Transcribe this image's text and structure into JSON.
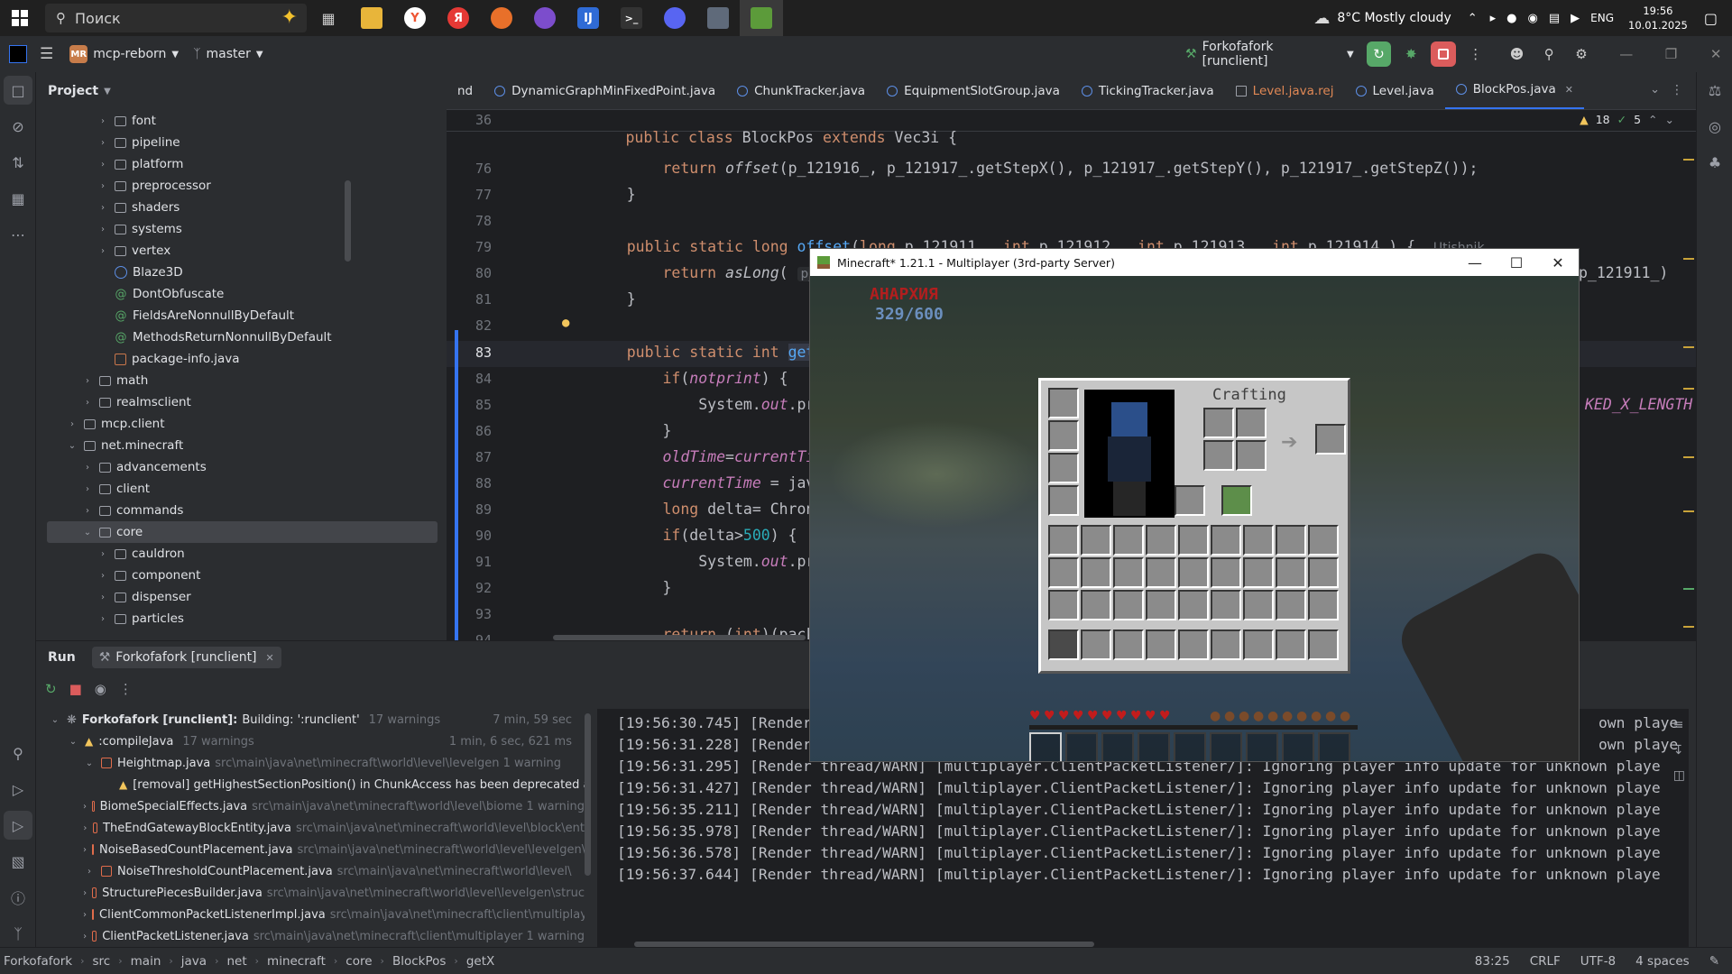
{
  "taskbar": {
    "search_placeholder": "Поиск",
    "weather": "8°C  Mostly cloudy",
    "lang": "ENG",
    "time": "19:56",
    "date": "10.01.2025"
  },
  "ide": {
    "project_badge": "MR",
    "project_name": "mcp-reborn",
    "branch": "master",
    "run_config": "Forkofafork [runclient]"
  },
  "project_panel": {
    "title": "Project",
    "items": [
      {
        "label": "font",
        "type": "folder",
        "depth": 3
      },
      {
        "label": "pipeline",
        "type": "folder",
        "depth": 3
      },
      {
        "label": "platform",
        "type": "folder",
        "depth": 3
      },
      {
        "label": "preprocessor",
        "type": "folder",
        "depth": 3
      },
      {
        "label": "shaders",
        "type": "folder",
        "depth": 3
      },
      {
        "label": "systems",
        "type": "folder",
        "depth": 3
      },
      {
        "label": "vertex",
        "type": "folder",
        "depth": 3
      },
      {
        "label": "Blaze3D",
        "type": "class",
        "depth": 3
      },
      {
        "label": "DontObfuscate",
        "type": "annotation",
        "depth": 3
      },
      {
        "label": "FieldsAreNonnullByDefault",
        "type": "annotation",
        "depth": 3
      },
      {
        "label": "MethodsReturnNonnullByDefault",
        "type": "annotation",
        "depth": 3
      },
      {
        "label": "package-info.java",
        "type": "file",
        "depth": 3
      },
      {
        "label": "math",
        "type": "folder",
        "depth": 2
      },
      {
        "label": "realmsclient",
        "type": "folder",
        "depth": 2
      },
      {
        "label": "mcp.client",
        "type": "folder",
        "depth": 1
      },
      {
        "label": "net.minecraft",
        "type": "folder-open",
        "depth": 1
      },
      {
        "label": "advancements",
        "type": "folder",
        "depth": 2
      },
      {
        "label": "client",
        "type": "folder",
        "depth": 2
      },
      {
        "label": "commands",
        "type": "folder",
        "depth": 2
      },
      {
        "label": "core",
        "type": "folder-open",
        "depth": 2,
        "selected": true
      },
      {
        "label": "cauldron",
        "type": "folder",
        "depth": 3
      },
      {
        "label": "component",
        "type": "folder",
        "depth": 3
      },
      {
        "label": "dispenser",
        "type": "folder",
        "depth": 3
      },
      {
        "label": "particles",
        "type": "folder",
        "depth": 3
      }
    ]
  },
  "editor": {
    "tabs": [
      {
        "label": "nd",
        "state": "normal"
      },
      {
        "label": "DynamicGraphMinFixedPoint.java",
        "state": "normal"
      },
      {
        "label": "ChunkTracker.java",
        "state": "normal"
      },
      {
        "label": "EquipmentSlotGroup.java",
        "state": "normal"
      },
      {
        "label": "TickingTracker.java",
        "state": "normal"
      },
      {
        "label": "Level.java.rej",
        "state": "rej"
      },
      {
        "label": "Level.java",
        "state": "normal"
      },
      {
        "label": "BlockPos.java",
        "state": "active"
      }
    ],
    "inspection_warnings": "18",
    "inspection_ok": "5",
    "sticky_line_no": "36",
    "sticky_line": "public class BlockPos extends Vec3i {",
    "author_hint": "Utishnik",
    "right_overflow_1": "p_121911_)",
    "right_overflow_2": "KED_X_LENGTH"
  },
  "run_panel": {
    "tab_run": "Run",
    "tab_config": "Forkofafork [runclient]",
    "build_root": "Forkofafork [runclient]:",
    "build_root_status": "Building: ':runclient'",
    "build_root_warnings": "17 warnings",
    "build_root_time": "7 min, 59 sec",
    "compile_label": ":compileJava",
    "compile_warnings": "17 warnings",
    "compile_time": "1 min, 6 sec, 621 ms",
    "rows": [
      {
        "name": "Heightmap.java",
        "path": "src\\main\\java\\net\\minecraft\\world\\level\\levelgen 1 warning",
        "indent": 3,
        "open": true
      },
      {
        "name": "[removal] getHighestSectionPosition() in ChunkAccess has been deprecated ar",
        "path": "",
        "indent": 4,
        "warn": true
      },
      {
        "name": "BiomeSpecialEffects.java",
        "path": "src\\main\\java\\net\\minecraft\\world\\level\\biome 1 warning",
        "indent": 3
      },
      {
        "name": "TheEndGatewayBlockEntity.java",
        "path": "src\\main\\java\\net\\minecraft\\world\\level\\block\\ent",
        "indent": 3
      },
      {
        "name": "NoiseBasedCountPlacement.java",
        "path": "src\\main\\java\\net\\minecraft\\world\\level\\levelgen\\",
        "indent": 3
      },
      {
        "name": "NoiseThresholdCountPlacement.java",
        "path": "src\\main\\java\\net\\minecraft\\world\\level\\",
        "indent": 3
      },
      {
        "name": "StructurePiecesBuilder.java",
        "path": "src\\main\\java\\net\\minecraft\\world\\level\\levelgen\\struc",
        "indent": 3
      },
      {
        "name": "ClientCommonPacketListenerImpl.java",
        "path": "src\\main\\java\\net\\minecraft\\client\\multiplaye",
        "indent": 3
      },
      {
        "name": "ClientPacketListener.java",
        "path": "src\\main\\java\\net\\minecraft\\client\\multiplayer 1 warning",
        "indent": 3
      }
    ],
    "console_lines": [
      "[19:56:30.745] [Render t",
      "[19:56:31.228] [Render t",
      "[19:56:31.295] [Render thread/WARN] [multiplayer.ClientPacketListener/]: Ignoring player info update for unknown playe",
      "[19:56:31.427] [Render thread/WARN] [multiplayer.ClientPacketListener/]: Ignoring player info update for unknown playe",
      "[19:56:35.211] [Render thread/WARN] [multiplayer.ClientPacketListener/]: Ignoring player info update for unknown playe",
      "[19:56:35.978] [Render thread/WARN] [multiplayer.ClientPacketListener/]: Ignoring player info update for unknown playe",
      "[19:56:36.578] [Render thread/WARN] [multiplayer.ClientPacketListener/]: Ignoring player info update for unknown playe",
      "[19:56:37.644] [Render thread/WARN] [multiplayer.ClientPacketListener/]: Ignoring player info update for unknown playe"
    ],
    "console_right_1": "own playe",
    "console_right_2": "own playe"
  },
  "minecraft": {
    "title": "Minecraft* 1.21.1 - Multiplayer (3rd-party Server)",
    "hud_title": "АНАРХИЯ",
    "hud_count": "329/600",
    "crafting_label": "Crafting"
  },
  "status_bar": {
    "crumbs": [
      "Forkofafork",
      "src",
      "main",
      "java",
      "net",
      "minecraft",
      "core",
      "BlockPos",
      "getX"
    ],
    "position": "83:25",
    "line_sep": "CRLF",
    "encoding": "UTF-8",
    "indent": "4 spaces"
  },
  "colors": {
    "ide_bg": "#1e1f22",
    "panel_bg": "#2b2d30",
    "accent": "#3574f0",
    "keyword": "#cf8e6d",
    "function": "#56a8f5"
  }
}
